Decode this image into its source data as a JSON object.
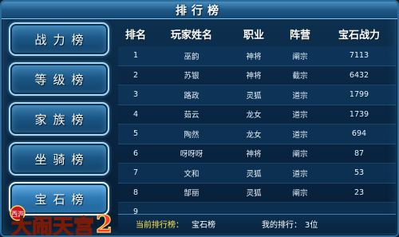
{
  "window": {
    "title": "排行榜"
  },
  "sidebar": {
    "items": [
      {
        "label": "战力榜"
      },
      {
        "label": "等级榜"
      },
      {
        "label": "家族榜"
      },
      {
        "label": "坐骑榜"
      },
      {
        "label": "宝石榜"
      }
    ]
  },
  "logo": {
    "text": "大闹天宫",
    "numeral": "2",
    "badge": "西游"
  },
  "table": {
    "headers": [
      "排名",
      "玩家姓名",
      "职业",
      "阵营",
      "宝石战力"
    ],
    "rows": [
      {
        "rank": "1",
        "name": "巫韵",
        "job": "神将",
        "camp": "阐宗",
        "power": "7113"
      },
      {
        "rank": "2",
        "name": "苏银",
        "job": "神将",
        "camp": "截宗",
        "power": "6432"
      },
      {
        "rank": "3",
        "name": "路政",
        "job": "灵狐",
        "camp": "道宗",
        "power": "1799"
      },
      {
        "rank": "4",
        "name": "茹云",
        "job": "龙女",
        "camp": "道宗",
        "power": "1739"
      },
      {
        "rank": "5",
        "name": "陶然",
        "job": "龙女",
        "camp": "道宗",
        "power": "694"
      },
      {
        "rank": "6",
        "name": "呀呀呀",
        "job": "神将",
        "camp": "阐宗",
        "power": "87"
      },
      {
        "rank": "7",
        "name": "文和",
        "job": "灵狐",
        "camp": "道宗",
        "power": "53"
      },
      {
        "rank": "8",
        "name": "郜丽",
        "job": "灵狐",
        "camp": "阐宗",
        "power": "23"
      },
      {
        "rank": "9",
        "name": "",
        "job": "",
        "camp": "",
        "power": ""
      }
    ]
  },
  "footer": {
    "current_label": "当前排行榜：",
    "current_value": "宝石榜",
    "my_rank_label": "我的排行：",
    "my_rank_value": "3位"
  }
}
